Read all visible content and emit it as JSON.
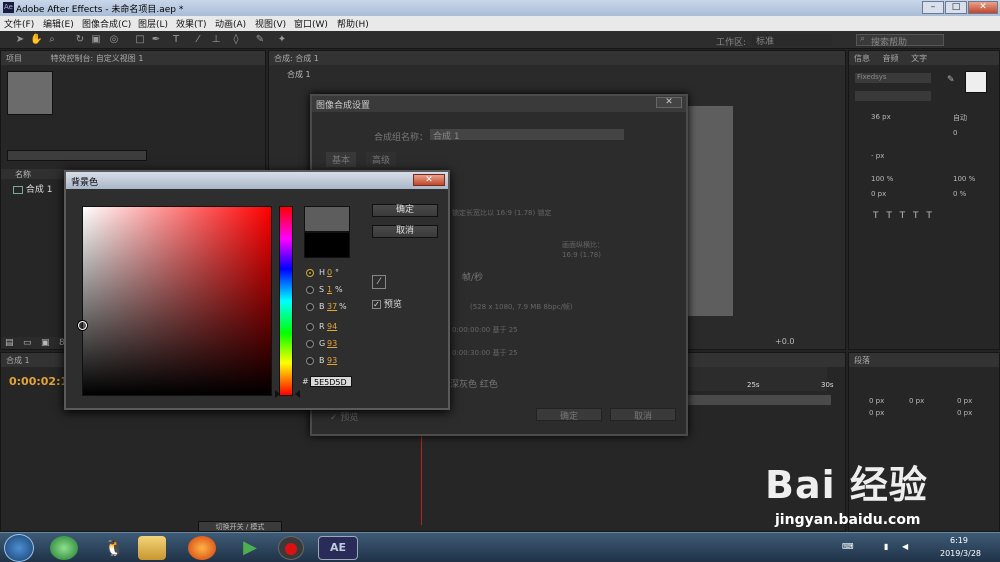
{
  "window": {
    "title": "Adobe After Effects - 未命名项目.aep *"
  },
  "menu": [
    "文件(F)",
    "编辑(E)",
    "图像合成(C)",
    "图层(L)",
    "效果(T)",
    "动画(A)",
    "视图(V)",
    "窗口(W)",
    "帮助(H)"
  ],
  "toolbar": {
    "workspace_label": "工作区:",
    "workspace_value": "标准",
    "search_placeholder": "搜索帮助"
  },
  "project_panel": {
    "tab1": "项目",
    "tab2": "特效控制台: 自定义视图 1",
    "col_name": "名称",
    "item": "合成 1",
    "bit_depth": "8"
  },
  "comp_panel": {
    "tab": "合成: 合成 1",
    "crumb": "合成 1",
    "zoom": "+0.0"
  },
  "timeline": {
    "tab": "合成 1",
    "timecode": "0:00:02:1",
    "mark_25": "25s",
    "mark_30": "30s",
    "switch_mode": "切换开关 / 模式"
  },
  "right_panel": {
    "tabs": [
      "信息",
      "音频",
      "文字"
    ],
    "font": "Fixedsys",
    "size": "36 px",
    "auto": "自动",
    "tracking": "0",
    "leading": "- px",
    "scale_v": "100 %",
    "scale_h": "100 %",
    "baseline": "0 px",
    "tsume": "0 %",
    "para_tab": "段落",
    "para_vals": [
      "0 px",
      "0 px",
      "0 px",
      "0 px",
      "0 px"
    ]
  },
  "comp_settings_dialog": {
    "title": "图像合成设置",
    "name_label": "合成组名称：",
    "name_value": "合成 1",
    "tab_basic": "基本",
    "tab_adv": "高级",
    "aspect_note": "锁定长宽比以 16:9 (1.78) 锁定",
    "pixel_aspect": "画面纵横比：",
    "pixel_aspect_val": "16:9 (1.78)",
    "fps_unit": "帧/秒",
    "size_info": "(528 x 1080, 7.9 MB 8bpc/帧)",
    "start_tc": "0:00:00:00  基于 25",
    "duration": "0:00:30:00  基于 25",
    "bg_color": "深灰色 红色",
    "preview": "预览",
    "ok": "确定",
    "cancel": "取消"
  },
  "color_picker": {
    "title": "背景色",
    "ok": "确定",
    "cancel": "取消",
    "preview_label": "预览",
    "fields": [
      {
        "label": "H",
        "value": "0",
        "unit": "°"
      },
      {
        "label": "S",
        "value": "1",
        "unit": "%"
      },
      {
        "label": "B",
        "value": "37",
        "unit": "%"
      },
      {
        "label": "R",
        "value": "94",
        "unit": ""
      },
      {
        "label": "G",
        "value": "93",
        "unit": ""
      },
      {
        "label": "B",
        "value": "93",
        "unit": ""
      }
    ],
    "hex_label": "#",
    "hex_value": "5E5D5D",
    "new_color": "#5e5d5d",
    "old_color": "#000000"
  },
  "taskbar": {
    "time": "6:19",
    "date": "2019/3/28"
  },
  "watermark": {
    "brand": "Bai 经验",
    "url": "jingyan.baidu.com"
  }
}
